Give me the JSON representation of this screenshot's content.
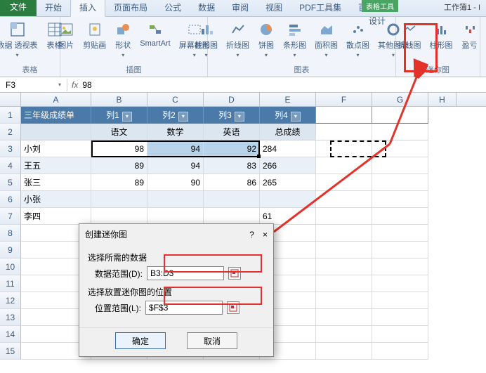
{
  "title": "工作簿1 - I",
  "tabs": {
    "file": "文件",
    "home": "开始",
    "insert": "插入",
    "layout": "页面布局",
    "formula": "公式",
    "data": "数据",
    "review": "审阅",
    "view": "视图",
    "pdf": "PDF工具集",
    "baidu": "百度网盘"
  },
  "context": {
    "group_label": "表格工具",
    "design": "设计"
  },
  "ribbon": {
    "groups": {
      "tables": {
        "label": "表格",
        "pivot": "数据\n透视表",
        "table": "表格"
      },
      "illustrations": {
        "label": "插图",
        "picture": "图片",
        "clipart": "剪贴画",
        "shapes": "形状",
        "smartart": "SmartArt",
        "screenshot": "屏幕截图"
      },
      "charts": {
        "label": "图表",
        "column": "柱形图",
        "line": "折线图",
        "pie": "饼图",
        "bar": "条形图",
        "area": "面积图",
        "scatter": "散点图",
        "other": "其他图表"
      },
      "sparklines": {
        "label": "迷你图",
        "line": "折线图",
        "column": "柱形图",
        "winloss": "盈亏"
      }
    }
  },
  "name_box": "F3",
  "formula_value": "98",
  "columns": [
    "A",
    "B",
    "C",
    "D",
    "E",
    "F",
    "G",
    "H"
  ],
  "row_numbers": [
    "1",
    "2",
    "3",
    "4",
    "5",
    "6",
    "7",
    "8",
    "9",
    "10",
    "11",
    "12",
    "13",
    "14",
    "15"
  ],
  "table": {
    "title": "三年级成绩单",
    "headers": [
      "列1",
      "列2",
      "列3",
      "列4"
    ],
    "sub_headers": [
      "语文",
      "数学",
      "英语",
      "总成绩"
    ],
    "rows": [
      {
        "name": "小刘",
        "v": [
          "98",
          "94",
          "92",
          "284"
        ]
      },
      {
        "name": "王五",
        "v": [
          "89",
          "94",
          "83",
          "266"
        ]
      },
      {
        "name": "张三",
        "v": [
          "89",
          "90",
          "86",
          "265"
        ]
      },
      {
        "name": "小张",
        "v": [
          "",
          "",
          "",
          ""
        ]
      },
      {
        "name": "李四",
        "v": [
          "",
          "",
          "",
          "61"
        ]
      }
    ]
  },
  "dialog": {
    "title": "创建迷你图",
    "section1": "选择所需的数据",
    "data_range_label": "数据范围(D):",
    "data_range_value": "B3:D3",
    "section2": "选择放置迷你图的位置",
    "location_label": "位置范围(L):",
    "location_value": "$F$3",
    "ok": "确定",
    "cancel": "取消",
    "help": "?",
    "close": "×"
  }
}
